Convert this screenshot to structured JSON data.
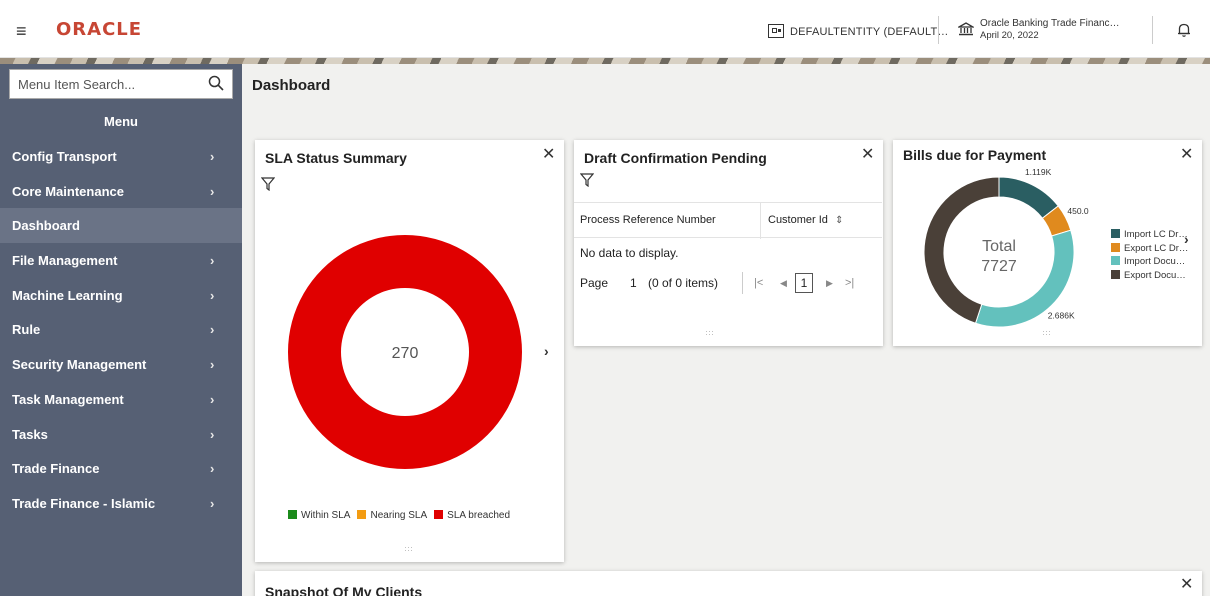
{
  "header": {
    "logo": "ORACLE",
    "entity": "DEFAULTENTITY (DEFAULT…",
    "bank_name": "Oracle Banking Trade Financ…",
    "date": "April 20, 2022"
  },
  "sidebar": {
    "search_placeholder": "Menu Item Search...",
    "menu_title": "Menu",
    "items": [
      {
        "label": "Config Transport",
        "has_children": true
      },
      {
        "label": "Core Maintenance",
        "has_children": true
      },
      {
        "label": "Dashboard",
        "has_children": false,
        "active": true
      },
      {
        "label": "File Management",
        "has_children": true
      },
      {
        "label": "Machine Learning",
        "has_children": true
      },
      {
        "label": "Rule",
        "has_children": true
      },
      {
        "label": "Security Management",
        "has_children": true
      },
      {
        "label": "Task Management",
        "has_children": true
      },
      {
        "label": "Tasks",
        "has_children": true
      },
      {
        "label": "Trade Finance",
        "has_children": true
      },
      {
        "label": "Trade Finance - Islamic",
        "has_children": true
      }
    ]
  },
  "main": {
    "title": "Dashboard"
  },
  "sla_card": {
    "title": "SLA Status Summary",
    "center_value": "270",
    "legend": [
      {
        "label": "Within SLA",
        "color": "#1b8a1b"
      },
      {
        "label": "Nearing SLA",
        "color": "#f39c12"
      },
      {
        "label": "SLA breached",
        "color": "#e00000"
      }
    ]
  },
  "draft_card": {
    "title": "Draft Confirmation Pending",
    "columns": [
      "Process Reference Number",
      "Customer Id"
    ],
    "empty_text": "No data to display.",
    "pager": {
      "page_label": "Page",
      "page_number": "1",
      "items_text": "(0 of 0 items)",
      "current_page": "1"
    }
  },
  "bills_card": {
    "title": "Bills due for Payment",
    "center_label": "Total",
    "center_value": "7727",
    "slices": [
      {
        "name": "Import LC Dr…",
        "value": 1119,
        "label": "1.119K",
        "color": "#2a5e62"
      },
      {
        "name": "Export LC Dr…",
        "value": 450,
        "label": "450.0",
        "color": "#e08a1e"
      },
      {
        "name": "Import Docu…",
        "value": 2686,
        "label": "2.686K",
        "color": "#63c1bd"
      },
      {
        "name": "Export Docu…",
        "value": 3472,
        "label": "",
        "color": "#4a4038"
      }
    ]
  },
  "snapshot_card": {
    "title": "Snapshot Of My Clients"
  },
  "colors": {
    "oracle_red": "#c74634",
    "sidebar_bg": "#566074",
    "sidebar_active": "#6a7386"
  }
}
